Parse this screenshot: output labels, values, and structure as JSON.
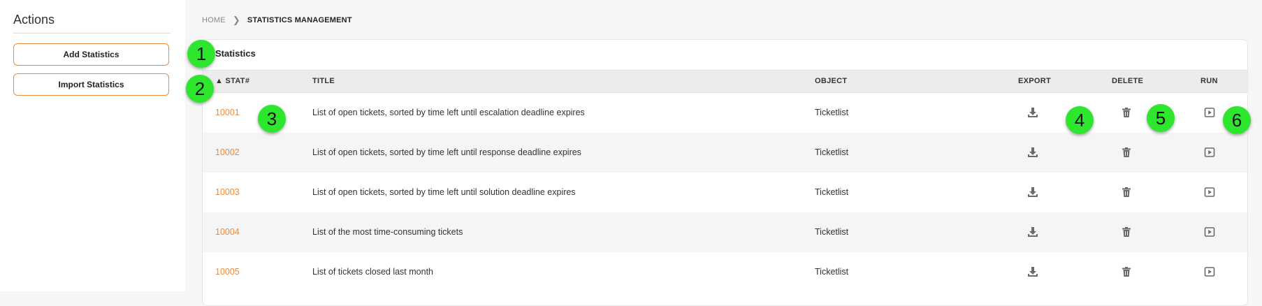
{
  "sidebar": {
    "title": "Actions",
    "buttons": [
      "Add Statistics",
      "Import Statistics"
    ]
  },
  "breadcrumb": {
    "home": "HOME",
    "current": "STATISTICS MANAGEMENT"
  },
  "panel": {
    "title": "Statistics",
    "columns": {
      "stat": "▲ STAT#",
      "title": "TITLE",
      "object": "OBJECT",
      "export": "EXPORT",
      "delete": "DELETE",
      "run": "RUN"
    },
    "rows": [
      {
        "num": "10001",
        "title": "List of open tickets, sorted by time left until escalation deadline expires",
        "object": "Ticketlist"
      },
      {
        "num": "10002",
        "title": "List of open tickets, sorted by time left until response deadline expires",
        "object": "Ticketlist"
      },
      {
        "num": "10003",
        "title": "List of open tickets, sorted by time left until solution deadline expires",
        "object": "Ticketlist"
      },
      {
        "num": "10004",
        "title": "List of the most time-consuming tickets",
        "object": "Ticketlist"
      },
      {
        "num": "10005",
        "title": "List of tickets closed last month",
        "object": "Ticketlist"
      }
    ]
  },
  "icons": {
    "export": "download-icon",
    "delete": "trash-icon",
    "run": "play-icon"
  },
  "callouts": [
    "1",
    "2",
    "3",
    "4",
    "5",
    "6"
  ],
  "colors": {
    "accent": "#f08a38",
    "callout": "#2ee62e"
  }
}
